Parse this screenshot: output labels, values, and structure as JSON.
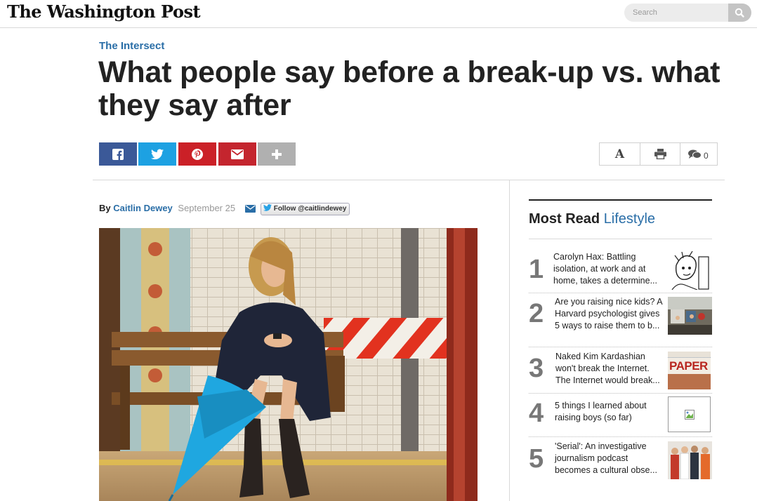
{
  "masthead": {
    "logo": "The Washington Post"
  },
  "search": {
    "placeholder": "Search"
  },
  "article": {
    "section": "The Intersect",
    "headline": "What people say before a break-up vs. what they say after",
    "byline_prefix": "By",
    "author": "Caitlin Dewey",
    "date": "September 25",
    "follow_label": "Follow @caitlindewey"
  },
  "tools": {
    "font_label": "A",
    "comment_count": "0"
  },
  "share_colors": {
    "facebook": "#3b5998",
    "twitter": "#1da1e2",
    "pinterest": "#cb2027",
    "email": "#c4252e",
    "more": "#b0b0b0"
  },
  "sidebar": {
    "title_bold": "Most Read",
    "title_section": "Lifestyle",
    "items": [
      {
        "rank": "1",
        "text": "Carolyn Hax: Battling isolation, at work and at home, takes a determine..."
      },
      {
        "rank": "2",
        "text": "Are you raising nice kids? A Harvard psychologist gives 5 ways to raise them to b..."
      },
      {
        "rank": "3",
        "text": "Naked Kim Kardashian won't break the Internet. The Internet would break...",
        "thumb_text": "PAPER"
      },
      {
        "rank": "4",
        "text": "5 things I learned about raising boys (so far)"
      },
      {
        "rank": "5",
        "text": "'Serial': An investigative journalism podcast becomes a cultural obse..."
      }
    ]
  }
}
